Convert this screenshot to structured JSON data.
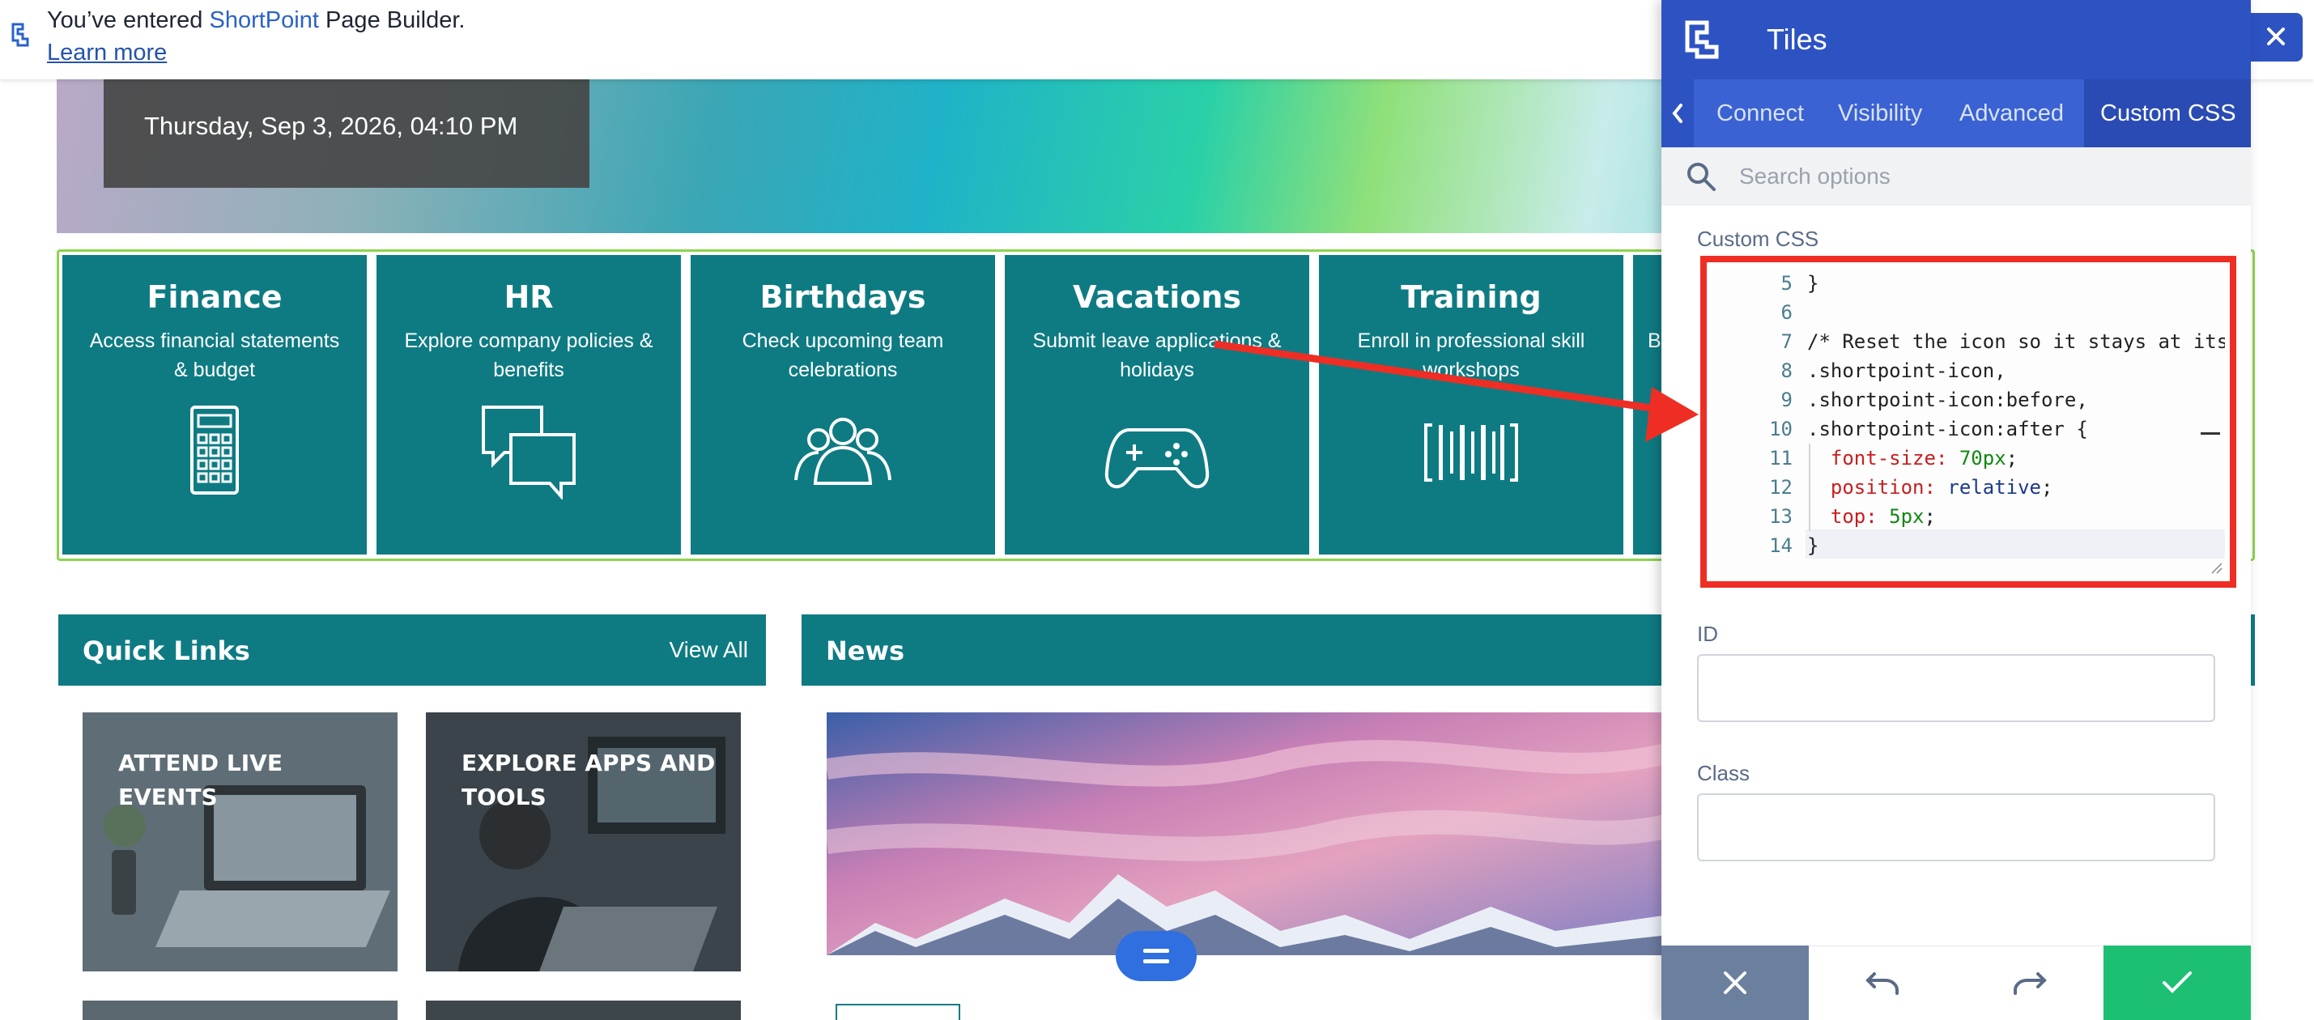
{
  "notification": {
    "prefix": "You’ve entered ",
    "brand": "ShortPoint",
    "suffix": " Page Builder.",
    "learn_more": "Learn more"
  },
  "hero": {
    "date": "Thursday, Sep 3, 2026, 04:10 PM"
  },
  "tiles": [
    {
      "title": "Finance",
      "desc": "Access financial statements & budget",
      "icon": "calculator-icon"
    },
    {
      "title": "HR",
      "desc": "Explore company policies & benefits",
      "icon": "chat-bubbles-icon"
    },
    {
      "title": "Birthdays",
      "desc": "Check upcoming team celebrations",
      "icon": "people-group-icon"
    },
    {
      "title": "Vacations",
      "desc": "Submit leave applications & holidays",
      "icon": "gamepad-icon"
    },
    {
      "title": "Training",
      "desc": "Enroll in professional skill workshops",
      "icon": "barcode-icon"
    },
    {
      "title": "",
      "desc": "Br",
      "icon": ""
    }
  ],
  "quick_links": {
    "title": "Quick Links",
    "view_all": "View All",
    "cards": [
      {
        "label": "ATTEND LIVE EVENTS"
      },
      {
        "label": "EXPLORE APPS AND TOOLS"
      }
    ]
  },
  "news": {
    "title": "News"
  },
  "panel": {
    "title": "Tiles",
    "tabs": [
      "Connect",
      "Visibility",
      "Advanced",
      "Custom CSS"
    ],
    "active_tab": "Custom CSS",
    "search_placeholder": "Search options",
    "custom_css_label": "Custom CSS",
    "code_lines": [
      {
        "n": "5",
        "text": "}"
      },
      {
        "n": "6",
        "text": ""
      },
      {
        "n": "7",
        "text": "/* Reset the icon so it stays at its"
      },
      {
        "n": "8",
        "text": ".shortpoint-icon,"
      },
      {
        "n": "9",
        "text": ".shortpoint-icon:before,"
      },
      {
        "n": "10",
        "text": ".shortpoint-icon:after {"
      },
      {
        "n": "11",
        "prop": "font-size:",
        "val": "70px",
        "end": ";"
      },
      {
        "n": "12",
        "prop": "position:",
        "val": "relative",
        "end": ";"
      },
      {
        "n": "13",
        "prop": "top:",
        "val": "5px",
        "end": ";"
      },
      {
        "n": "14",
        "text": "}"
      }
    ],
    "id_label": "ID",
    "id_value": "",
    "class_label": "Class",
    "class_value": ""
  },
  "colors": {
    "teal": "#0e7b83",
    "panel_blue": "#2d52c2",
    "highlight_red": "#ee2e24",
    "confirm_green": "#1dbf73",
    "tile_border_green": "#8cd44e"
  }
}
